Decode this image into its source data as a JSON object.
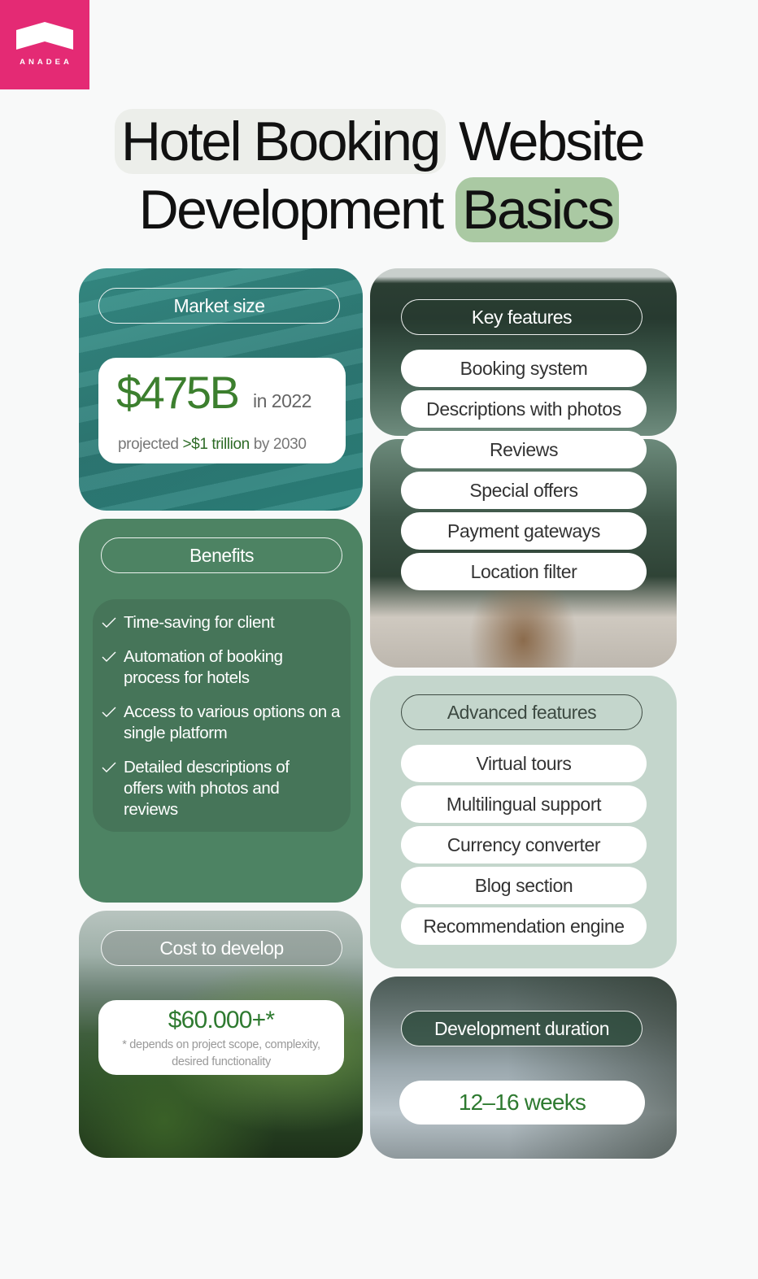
{
  "logo": {
    "text": "ANADEA",
    "color": "#e42a74"
  },
  "title": {
    "line1_highlight": "Hotel Booking",
    "line1_rest": "Website",
    "line2_rest": "Development",
    "line2_highlight": "Basics"
  },
  "market": {
    "heading": "Market size",
    "value": "$475B",
    "value_suffix": "in 2022",
    "projection_prefix": "projected",
    "projection_highlight": ">$1 trillion",
    "projection_suffix": "by 2030"
  },
  "benefits": {
    "heading": "Benefits",
    "items": [
      "Time-saving for client",
      "Automation of booking process for hotels",
      "Access to various options on a single platform",
      "Detailed descriptions of offers with photos and reviews"
    ]
  },
  "cost": {
    "heading": "Cost to develop",
    "value": "$60.000+*",
    "note": "* depends on project scope, complexity, desired functionality"
  },
  "key_features": {
    "heading": "Key features",
    "items": [
      "Booking system",
      "Descriptions with photos",
      "Reviews",
      "Special offers",
      "Payment gateways",
      "Location filter"
    ]
  },
  "advanced_features": {
    "heading": "Advanced features",
    "items": [
      "Virtual tours",
      "Multilingual support",
      "Currency converter",
      "Blog section",
      "Recommendation engine"
    ]
  },
  "duration": {
    "heading": "Development duration",
    "value": "12–16 weeks"
  },
  "colors": {
    "accent_green": "#3c7f2e",
    "market_teal": "#2f7d78",
    "benefits_green": "#4d8363",
    "advanced_sage": "#c4d6cc",
    "title_highlight_green": "#aac9a3"
  }
}
